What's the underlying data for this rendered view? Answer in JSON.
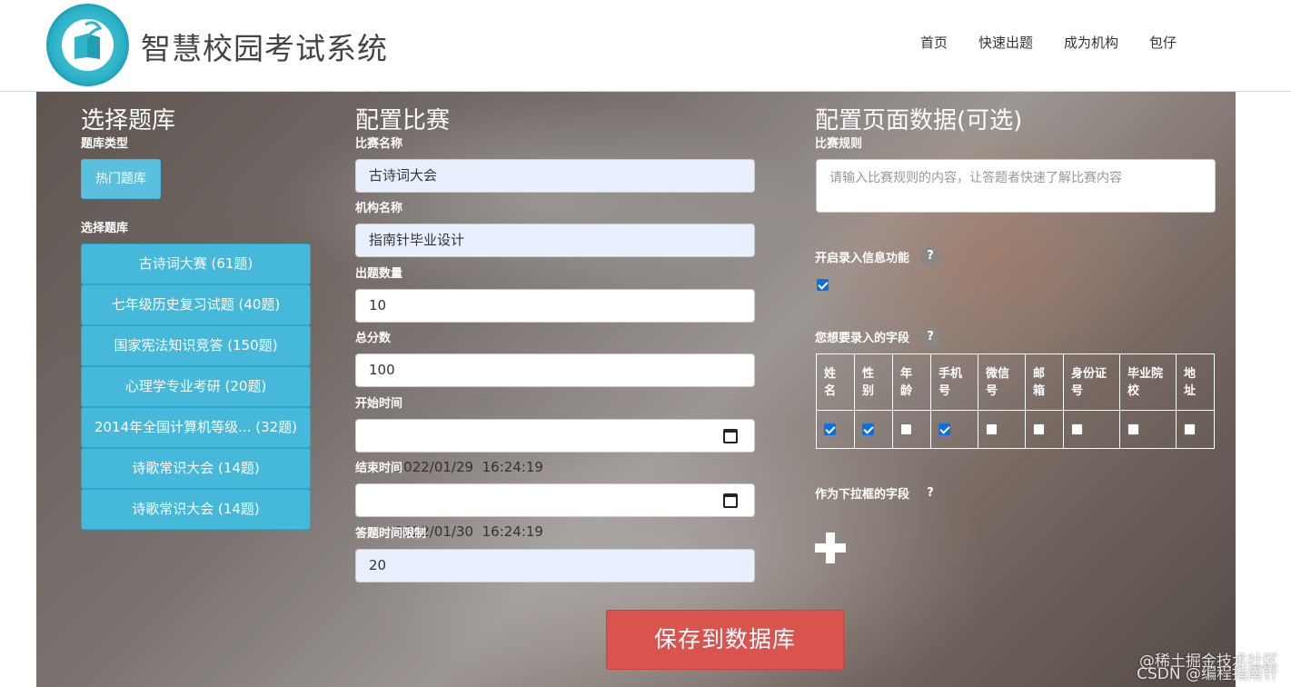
{
  "header": {
    "title": "智慧校园考试系统",
    "nav": [
      "首页",
      "快速出题",
      "成为机构",
      "包仔"
    ]
  },
  "left": {
    "heading": "选择题库",
    "type_label": "题库类型",
    "hot_button": "热门题库",
    "bank_label": "选择题库",
    "banks": [
      "古诗词大赛 (61题)",
      "七年级历史复习试题 (40题)",
      "国家宪法知识竞答 (150题)",
      "心理学专业考研 (20题)",
      "2014年全国计算机等级... (32题)",
      "诗歌常识大会 (14题)",
      "诗歌常识大会 (14题)"
    ]
  },
  "middle": {
    "heading": "配置比赛",
    "fields": [
      {
        "label": "比赛名称",
        "value": "古诗词大会"
      },
      {
        "label": "机构名称",
        "value": "指南针毕业设计"
      },
      {
        "label": "出题数量",
        "value": "10"
      },
      {
        "label": "总分数",
        "value": "100"
      },
      {
        "label": "开始时间",
        "value": "2022/01/29  16:24:19"
      },
      {
        "label": "结束时间",
        "value": "2022/01/30  16:24:19"
      },
      {
        "label": "答题时间限制",
        "value": "20"
      }
    ]
  },
  "right": {
    "heading": "配置页面数据(可选)",
    "rules_label": "比赛规则",
    "rules_placeholder": "请输入比赛规则的内容，让答题者快速了解比赛内容",
    "enable_label": "开启录入信息功能",
    "enable_checked": true,
    "fields_label": "您想要录入的字段",
    "help_symbol": "?",
    "field_columns": [
      {
        "name": "姓\n名",
        "checked": true
      },
      {
        "name": "性\n别",
        "checked": true
      },
      {
        "name": "年\n龄",
        "checked": false
      },
      {
        "name": "手机\n号",
        "checked": true
      },
      {
        "name": "微信\n号",
        "checked": false
      },
      {
        "name": "邮\n箱",
        "checked": false
      },
      {
        "name": "身份证\n号",
        "checked": false
      },
      {
        "name": "毕业院\n校",
        "checked": false
      },
      {
        "name": "地\n址",
        "checked": false
      }
    ],
    "dropdown_label": "作为下拉框的字段"
  },
  "save_button": "保存到数据库",
  "watermark": {
    "line1": "@稀土掘金技术社区",
    "line2": "CSDN @编程指南针"
  }
}
